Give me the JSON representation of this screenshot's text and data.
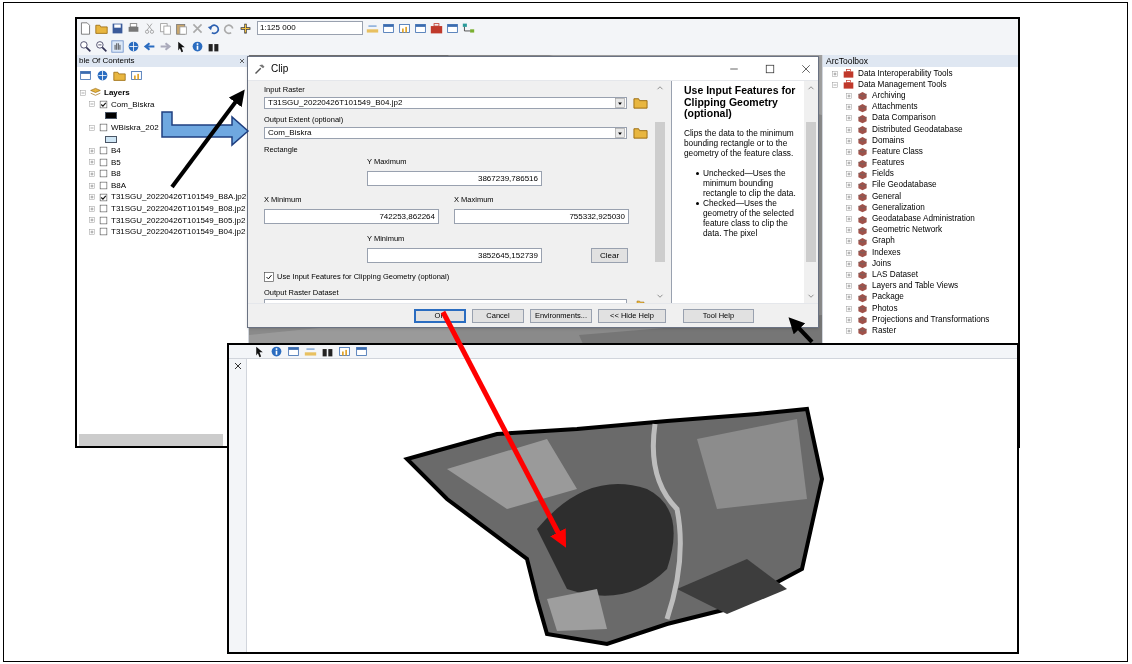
{
  "arcmap": {
    "scale": "1:125 000",
    "toc": {
      "title": "ble Of Contents",
      "root": {
        "label": "Layers",
        "expanded": true
      },
      "layers": [
        {
          "name": "Com_Biskra",
          "checked": true,
          "expanded": true,
          "color": "#000000"
        },
        {
          "name": "WBiskra_202",
          "checked": false,
          "expanded": true,
          "color": "#cfe6f5"
        },
        {
          "name": "B4",
          "checked": false,
          "expanded": false
        },
        {
          "name": "B5",
          "checked": false,
          "expanded": false
        },
        {
          "name": "B8",
          "checked": false,
          "expanded": false
        },
        {
          "name": "B8A",
          "checked": false,
          "expanded": false
        },
        {
          "name": "T31SGU_20220426T101549_B8A.jp2",
          "checked": true,
          "expanded": false
        },
        {
          "name": "T31SGU_20220426T101549_B08.jp2",
          "checked": false,
          "expanded": false
        },
        {
          "name": "T31SGU_20220426T101549_B05.jp2",
          "checked": false,
          "expanded": false
        },
        {
          "name": "T31SGU_20220426T101549_B04.jp2",
          "checked": false,
          "expanded": false
        }
      ]
    }
  },
  "clip_dialog": {
    "title": "Clip",
    "input_raster": {
      "label": "Input Raster",
      "value": "T31SGU_20220426T101549_B04.jp2"
    },
    "output_extent": {
      "label": "Output Extent (optional)",
      "value": "Com_Biskra"
    },
    "rectangle_label": "Rectangle",
    "y_maximum": {
      "label": "Y Maximum",
      "value": "3867239,786516"
    },
    "x_minimum": {
      "label": "X Minimum",
      "value": "742253,862264"
    },
    "x_maximum": {
      "label": "X Maximum",
      "value": "755332,925030"
    },
    "y_minimum": {
      "label": "Y Minimum",
      "value": "3852645,152739"
    },
    "clear_button": "Clear",
    "clip_geometry": {
      "label": "Use Input Features for Clipping Geometry (optional)",
      "checked": true
    },
    "output_raster": {
      "label": "Output Raster Dataset"
    },
    "buttons": [
      {
        "label": "OK",
        "default": true
      },
      {
        "label": "Cancel",
        "default": false
      },
      {
        "label": "Environments...",
        "default": false
      },
      {
        "label": "<< Hide Help",
        "default": false
      }
    ],
    "tool_help_button": "Tool Help",
    "help": {
      "title": "Use Input Features for Clipping Geometry (optional)",
      "text": "Clips the data to the minimum bounding rectangle or to the geometry of the feature class.",
      "bullets": [
        "Unchecked—Uses the minimum bounding rectangle to clip the data.",
        "Checked—Uses the geometry of the selected feature class to clip the data. The pixel"
      ]
    }
  },
  "arctoolbox": {
    "title": "ArcToolbox",
    "items": [
      {
        "label": "Data Interoperability Tools",
        "expanded": false
      },
      {
        "label": "Data Management Tools",
        "expanded": true,
        "children": [
          {
            "label": "Archiving",
            "expanded": false
          },
          {
            "label": "Attachments",
            "expanded": false
          },
          {
            "label": "Data Comparison",
            "expanded": false
          },
          {
            "label": "Distributed Geodatabase",
            "expanded": false
          },
          {
            "label": "Domains",
            "expanded": false
          },
          {
            "label": "Feature Class",
            "expanded": false
          },
          {
            "label": "Features",
            "expanded": false
          },
          {
            "label": "Fields",
            "expanded": false
          },
          {
            "label": "File Geodatabase",
            "expanded": false
          },
          {
            "label": "General",
            "expanded": false
          },
          {
            "label": "Generalization",
            "expanded": false
          },
          {
            "label": "Geodatabase Administration",
            "expanded": false
          },
          {
            "label": "Geometric Network",
            "expanded": false
          },
          {
            "label": "Graph",
            "expanded": false
          },
          {
            "label": "Indexes",
            "expanded": false
          },
          {
            "label": "Joins",
            "expanded": false
          },
          {
            "label": "LAS Dataset",
            "expanded": false
          },
          {
            "label": "Layers and Table Views",
            "expanded": false
          },
          {
            "label": "Package",
            "expanded": false
          },
          {
            "label": "Photos",
            "expanded": false
          },
          {
            "label": "Projections and Transformations",
            "expanded": false
          },
          {
            "label": "Raster",
            "expanded": false
          }
        ]
      }
    ]
  }
}
